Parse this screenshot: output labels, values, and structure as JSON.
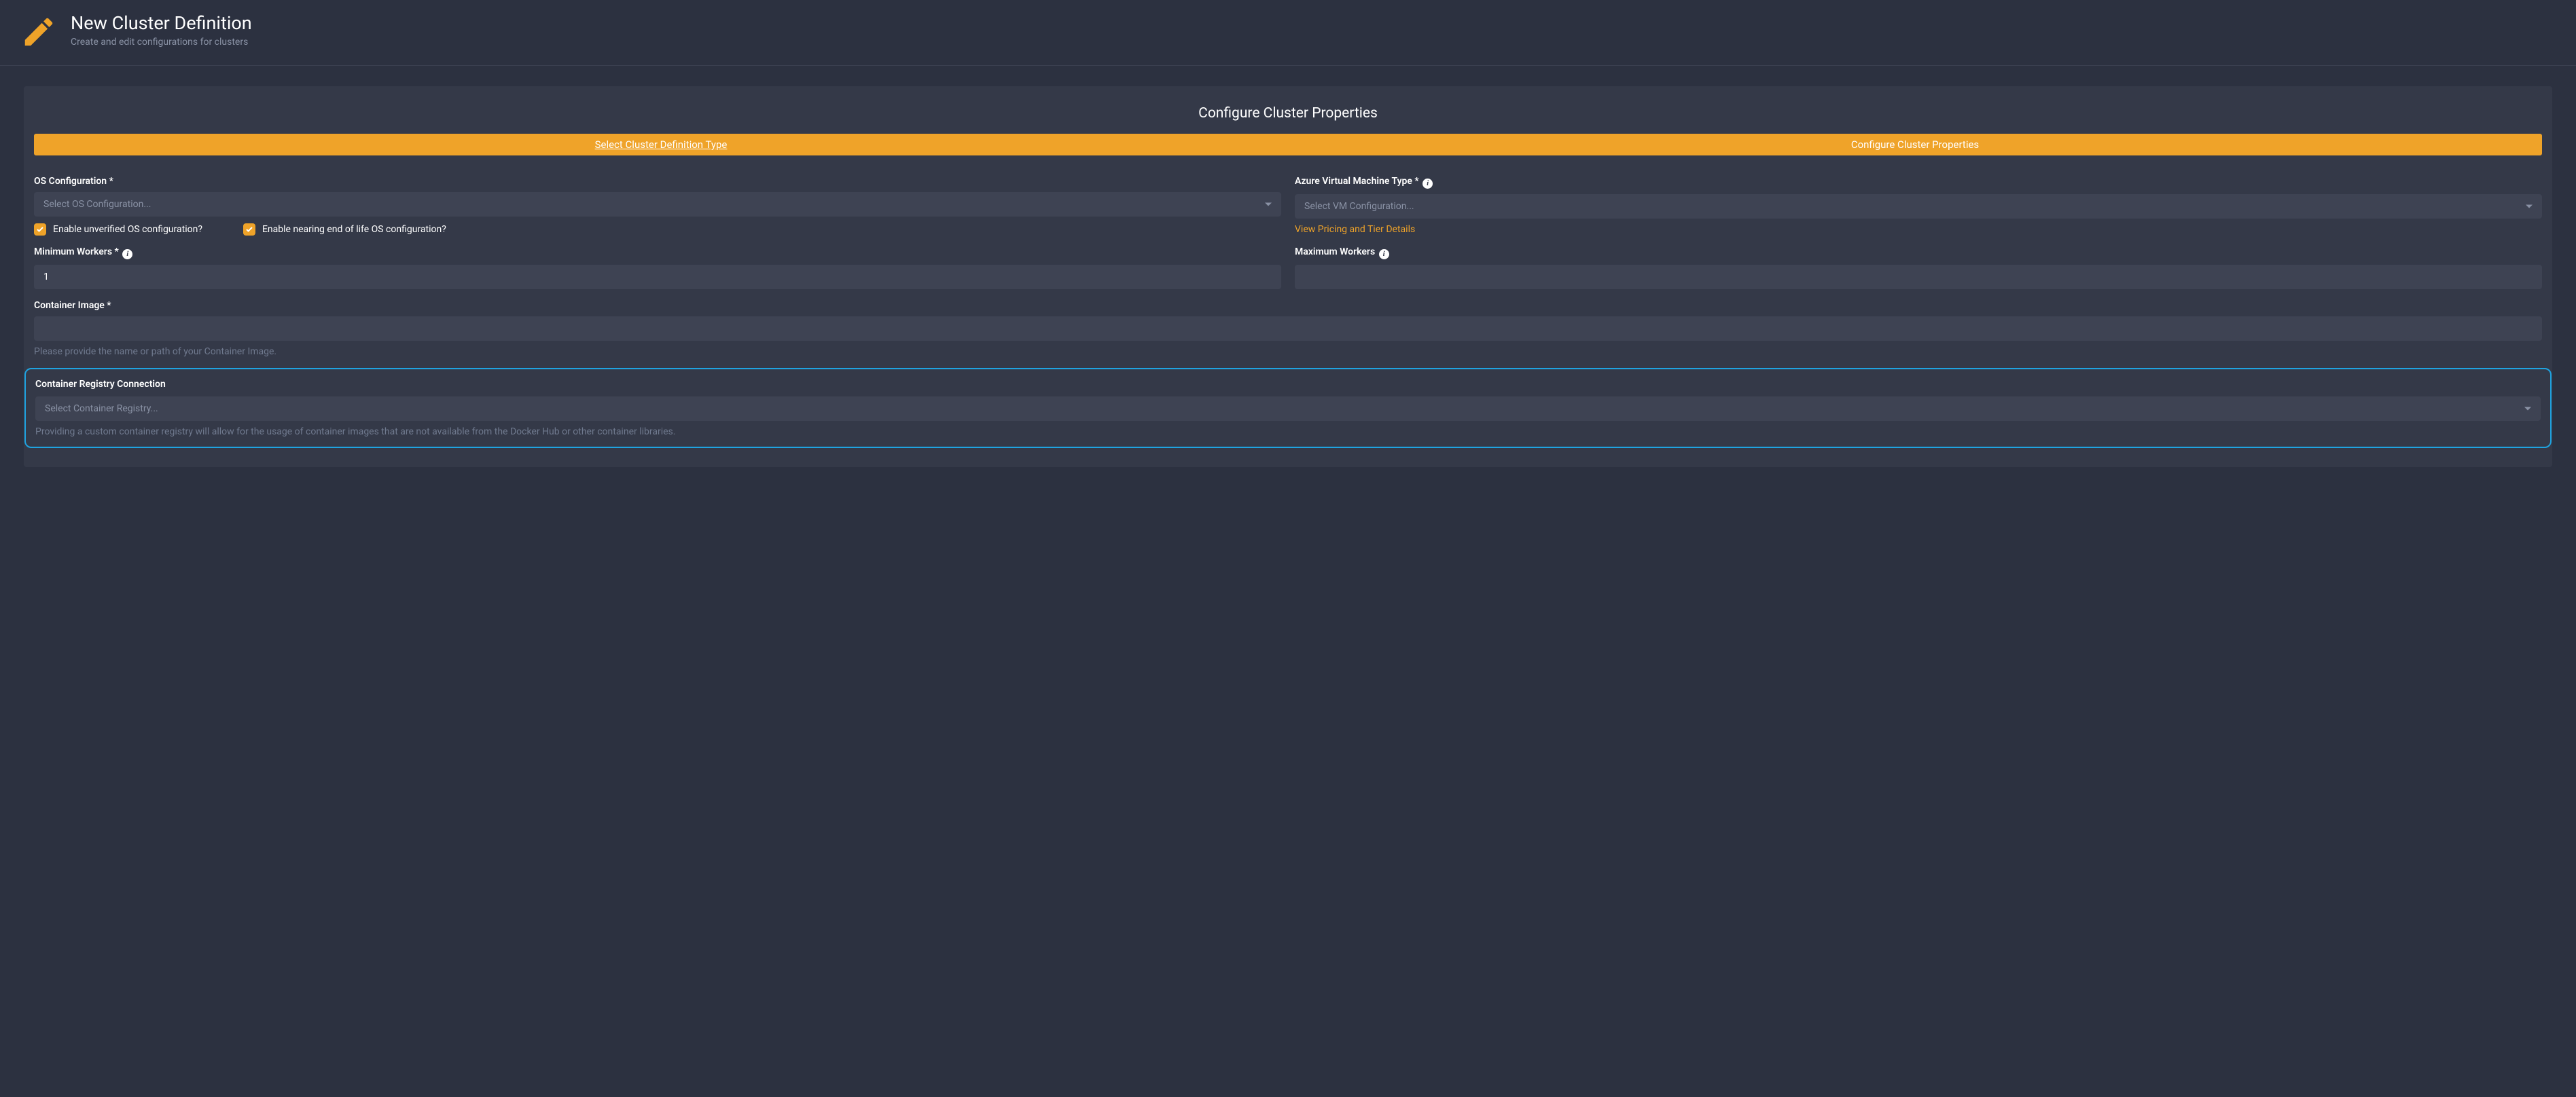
{
  "header": {
    "title": "New Cluster Definition",
    "subtitle": "Create and edit configurations for clusters"
  },
  "panel": {
    "heading": "Configure Cluster Properties",
    "steps": [
      {
        "label": "Select Cluster Definition Type",
        "linked": true
      },
      {
        "label": "Configure Cluster Properties",
        "linked": false
      }
    ]
  },
  "form": {
    "os_config": {
      "label": "OS Configuration *",
      "placeholder": "Select OS Configuration...",
      "checkbox1_label": "Enable unverified OS configuration?",
      "checkbox2_label": "Enable nearing end of life OS configuration?"
    },
    "vm_type": {
      "label": "Azure Virtual Machine Type * ",
      "placeholder": "Select VM Configuration...",
      "pricing_link": "View Pricing and Tier Details"
    },
    "min_workers": {
      "label": "Minimum Workers * ",
      "value": "1"
    },
    "max_workers": {
      "label": "Maximum Workers ",
      "value": ""
    },
    "container_image": {
      "label": "Container Image *",
      "value": "",
      "help": "Please provide the name or path of your Container Image."
    },
    "container_registry": {
      "label": "Container Registry Connection",
      "placeholder": "Select Container Registry...",
      "help": "Providing a custom container registry will allow for the usage of container images that are not available from the Docker Hub or other container libraries."
    }
  }
}
